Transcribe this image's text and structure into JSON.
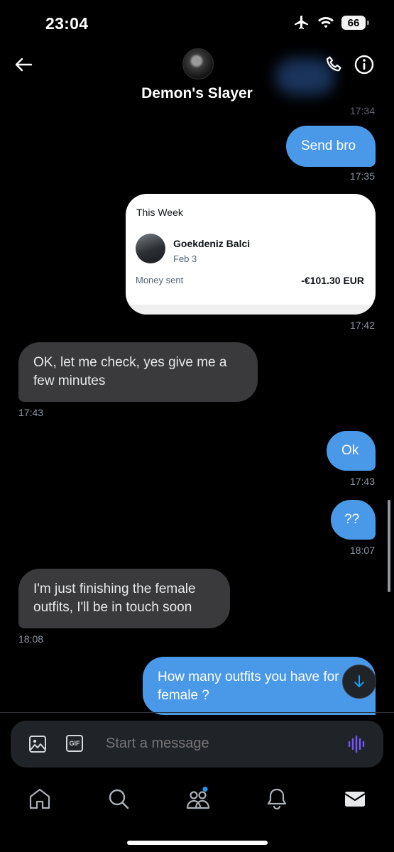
{
  "status": {
    "time": "23:04",
    "battery": "66"
  },
  "header": {
    "contact_name": "Demon's Slayer"
  },
  "messages": {
    "ts_cut": "17:34",
    "m1": {
      "text": "Send bro",
      "time": "17:35"
    },
    "card": {
      "heading": "This Week",
      "payee": "Goekdeniz Balci",
      "date": "Feb 3",
      "label": "Money sent",
      "amount": "-€101.30 EUR",
      "time": "17:42"
    },
    "m2": {
      "text": "OK, let me check, yes give me a few minutes",
      "time": "17:43"
    },
    "m3": {
      "text": "Ok",
      "time": "17:43"
    },
    "m4": {
      "text": "??",
      "time": "18:07"
    },
    "m5": {
      "text": "I'm just finishing the female outfits, I'll be in touch soon",
      "time": "18:08"
    },
    "m6": {
      "text": "How many outfits you have for female ?"
    }
  },
  "composer": {
    "placeholder": "Start a message",
    "gif_label": "GIF"
  },
  "colors": {
    "outgoing": "#4a99e9",
    "incoming": "#3a3a3c",
    "voice_accent": "#7856ff",
    "notification_dot": "#1d9bf0"
  },
  "icons": [
    "back-arrow-icon",
    "phone-icon",
    "info-icon",
    "image-icon",
    "gif-icon",
    "voice-icon",
    "home-icon",
    "search-icon",
    "communities-icon",
    "bell-icon",
    "mail-icon",
    "arrow-down-icon",
    "airplane-icon",
    "wifi-icon"
  ]
}
